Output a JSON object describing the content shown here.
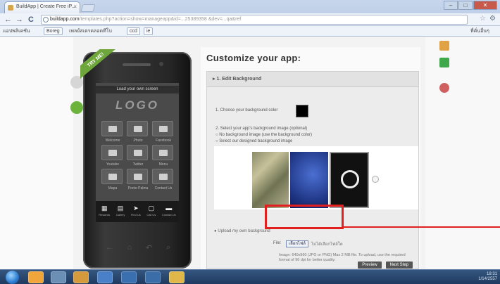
{
  "browser": {
    "tab_title": "BuildApp | Create Free iP...",
    "tab_close": "×",
    "url_host": "buildapp.com",
    "url_rest": "/templates.php?action=show=manageapp&id=...25389358 &dev=...qa&ref",
    "nav_back": "←",
    "nav_forward": "→",
    "nav_reload": "C",
    "star": "☆",
    "wrench": "⚙",
    "win_min": "–",
    "win_max": "□",
    "win_close": "✕"
  },
  "bookmarks": {
    "apps_label": "แอปพลิเคชัน",
    "btn1": "Boreg",
    "item2": "เพลย์สเตรคลอดทีโบ",
    "btn2": "ccd",
    "btn3": "ie",
    "other": "ที่คั่นอื่นๆ"
  },
  "phone": {
    "ribbon": "TRY ME!",
    "screen_title": "Load your own screen",
    "logo": "LOGO",
    "grid_labels": [
      "Welcome",
      "Photo",
      "Facebook",
      "Youtube",
      "Twitter",
      "Menu",
      "Mapa",
      "Ponte Palma",
      "Contact Us"
    ],
    "bottom": [
      {
        "glyph": "▦",
        "label": "Rewards"
      },
      {
        "glyph": "▤",
        "label": "Gallery"
      },
      {
        "glyph": "➤",
        "label": "Find Us"
      },
      {
        "glyph": "▢",
        "label": "Call Us"
      },
      {
        "glyph": "▬",
        "label": "Contact Us"
      }
    ],
    "hw_buttons": [
      "←",
      "⌂",
      "↶",
      "⌕"
    ]
  },
  "main": {
    "title": "Customize your app:",
    "panel_head": "▸ 1. Edit Background",
    "row_color": "1. Choose your background color",
    "row_img": "2. Select your app's background image (optional)",
    "row_opt1": "○ No background image (use the background color)",
    "row_opt2": "○ Select our designed background image",
    "row_upload": "● Upload my own background",
    "file_label": "File:",
    "browse_btn": "เลือกไฟล์",
    "no_file": "ไม่ได้เลือกไฟล์ใด",
    "note": "Image: 640x960 (JPG or PNG) Max 2 MB file. To upload, use the required format of 96 dpi for better quality.",
    "btn_preview": "Preview",
    "btn_next": "Next Step"
  },
  "accent": {
    "highlight": "#e21f1f"
  },
  "tray": {
    "time": "18:31",
    "date": "1/14/2557"
  },
  "icons": [
    "windows-start-icon",
    "ie-icon",
    "explorer-icon",
    "media-icon",
    "folder-icon",
    "chrome-icon"
  ]
}
